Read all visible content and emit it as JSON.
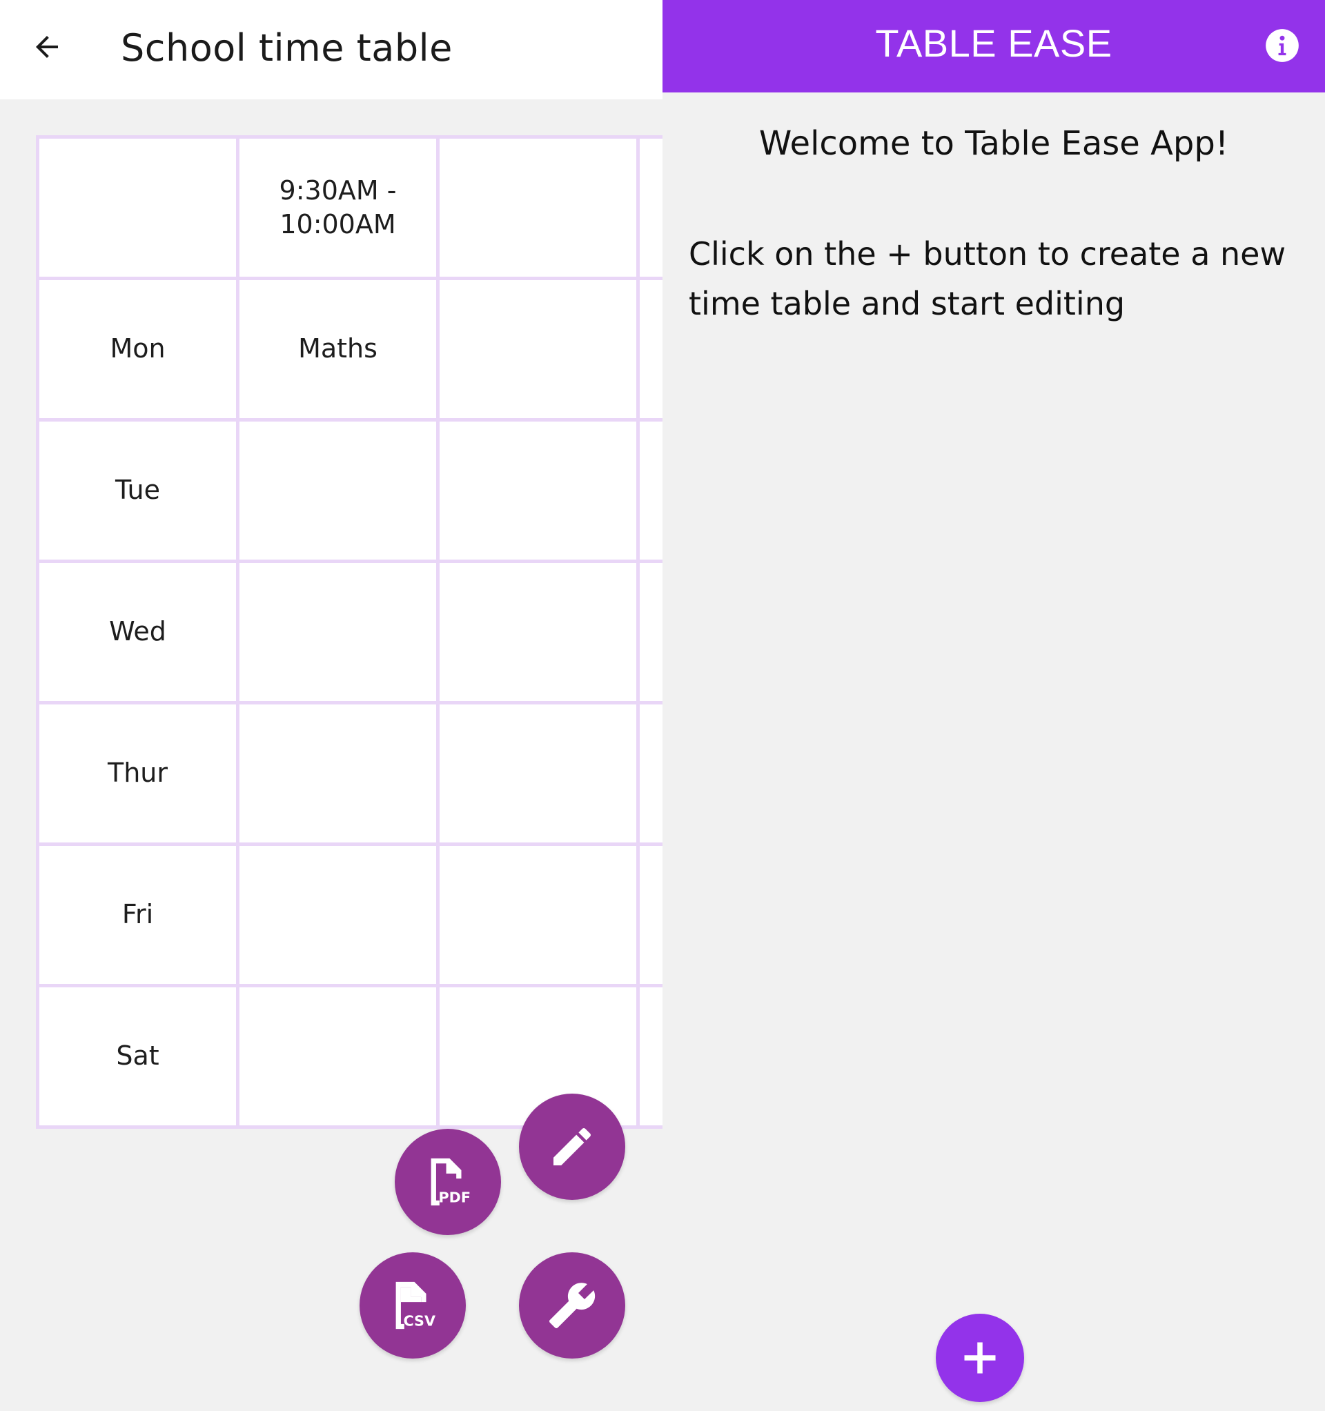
{
  "left_pane": {
    "title": "School time table",
    "back_icon": "arrow-left-icon",
    "timetable": {
      "header_row": [
        "",
        "9:30AM - 10:00AM",
        "",
        ""
      ],
      "rows": [
        {
          "day": "Mon",
          "cells": [
            "Maths",
            "",
            ""
          ]
        },
        {
          "day": "Tue",
          "cells": [
            "",
            "",
            ""
          ]
        },
        {
          "day": "Wed",
          "cells": [
            "",
            "",
            ""
          ]
        },
        {
          "day": "Thur",
          "cells": [
            "",
            "",
            ""
          ]
        },
        {
          "day": "Fri",
          "cells": [
            "",
            "",
            ""
          ]
        },
        {
          "day": "Sat",
          "cells": [
            "",
            "",
            ""
          ]
        }
      ]
    },
    "actions": {
      "edit_icon": "pencil-icon",
      "pdf_icon": "pdf-file-icon",
      "pdf_label": "PDF",
      "csv_icon": "csv-file-icon",
      "csv_label": "CSV",
      "settings_icon": "wrench-icon"
    }
  },
  "right_pane": {
    "app_title": "TABLE EASE",
    "info_icon": "info-icon",
    "welcome": "Welcome to Table Ease App!",
    "instructions": "Click on the + button to create a new time table and start editing",
    "add_icon": "plus-icon"
  },
  "colors": {
    "accent": "#9333ea",
    "fab": "#923594",
    "grid_border": "#e9d6f7",
    "background": "#f1f1f1"
  }
}
